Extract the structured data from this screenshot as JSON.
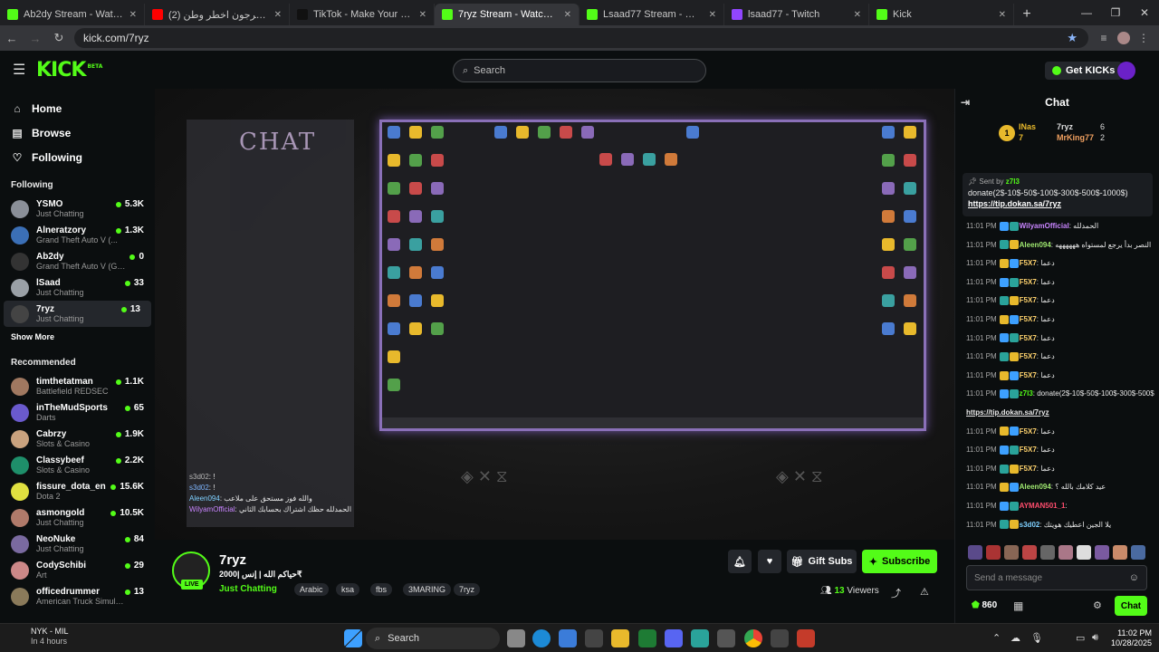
{
  "browser": {
    "tabs": [
      {
        "title": "Ab2dy Stream - Watch Live on K",
        "favicon_color": "#53fc18",
        "active": false
      },
      {
        "title": "اعضاء باور يحرجون اخطر وطن (2)",
        "favicon_color": "#ff0000",
        "active": false
      },
      {
        "title": "TikTok - Make Your Day",
        "favicon_color": "#111111",
        "active": false
      },
      {
        "title": "7ryz Stream - Watch Live on",
        "favicon_color": "#53fc18",
        "active": true
      },
      {
        "title": "Lsaad77 Stream - Watch Live o",
        "favicon_color": "#53fc18",
        "active": false
      },
      {
        "title": "lsaad77 - Twitch",
        "favicon_color": "#9146ff",
        "active": false
      },
      {
        "title": "Kick",
        "favicon_color": "#53fc18",
        "active": false
      }
    ],
    "url": "kick.com/7ryz"
  },
  "header": {
    "logo": "KICK",
    "logo_badge": "BETA",
    "search_placeholder": "Search",
    "get_kicks": "Get KICKs"
  },
  "sidebar": {
    "nav": [
      {
        "label": "Home",
        "icon": "home-icon"
      },
      {
        "label": "Browse",
        "icon": "browse-icon"
      },
      {
        "label": "Following",
        "icon": "heart-icon"
      }
    ],
    "following_title": "Following",
    "following": [
      {
        "name": "YSMO",
        "game": "Just Chatting",
        "viewers": "5.3K",
        "color": "#8a8f98"
      },
      {
        "name": "Alneratzory",
        "game": "Grand Theft Auto V (...",
        "viewers": "1.3K",
        "color": "#3b6fb6"
      },
      {
        "name": "Ab2dy",
        "game": "Grand Theft Auto V (GTA)",
        "viewers": "0",
        "color": "#333333"
      },
      {
        "name": "lSaad",
        "game": "Just Chatting",
        "viewers": "33",
        "color": "#9aa0a6"
      },
      {
        "name": "7ryz",
        "game": "Just Chatting",
        "viewers": "13",
        "color": "#444444"
      }
    ],
    "show_more": "Show More",
    "recommended_title": "Recommended",
    "recommended": [
      {
        "name": "timthetatman",
        "game": "Battlefield REDSEC",
        "viewers": "1.1K",
        "color": "#a07860"
      },
      {
        "name": "inTheMudSports",
        "game": "Darts",
        "viewers": "65",
        "color": "#6a5acd"
      },
      {
        "name": "Cabrzy",
        "game": "Slots & Casino",
        "viewers": "1.9K",
        "color": "#c9a27e"
      },
      {
        "name": "Classybeef",
        "game": "Slots & Casino",
        "viewers": "2.2K",
        "color": "#1e8f6a"
      },
      {
        "name": "fissure_dota_en",
        "game": "Dota 2",
        "viewers": "15.6K",
        "color": "#e0e040"
      },
      {
        "name": "asmongold",
        "game": "Just Chatting",
        "viewers": "10.5K",
        "color": "#b07a6a"
      },
      {
        "name": "NeoNuke",
        "game": "Just Chatting",
        "viewers": "84",
        "color": "#7a6aa0"
      },
      {
        "name": "CodySchibi",
        "game": "Art",
        "viewers": "29",
        "color": "#cc8888"
      },
      {
        "name": "officedrummer",
        "game": "American Truck Simulator",
        "viewers": "13",
        "color": "#8a7a5a"
      }
    ]
  },
  "player": {
    "chat_label": "CHAT",
    "overlay_chat": [
      {
        "user": "s3d02",
        "text": "!"
      },
      {
        "user": "s3d02",
        "text": "!"
      },
      {
        "user": "Aleen094",
        "text": "والله فوز مستحق على ملاعب"
      },
      {
        "user": "WilyamOfficial",
        "text": "الحمدلله حظك اشتراك بحسابك الثاني"
      }
    ]
  },
  "stream": {
    "name": "7ryz",
    "title": "حياكم الله | إنس |2000₹",
    "category": "Just Chatting",
    "tags": [
      "Arabic",
      "ksa",
      "fbs",
      "3MARING",
      "7ryz"
    ],
    "live": "LIVE",
    "gift_subs": "Gift Subs",
    "subscribe": "Subscribe",
    "viewers": "13",
    "viewers_label": "Viewers"
  },
  "chat": {
    "title": "Chat",
    "leaderboard": [
      {
        "name": "INas",
        "count": "7"
      },
      {
        "name": "7ryz",
        "count": "6"
      },
      {
        "name": "MrKing77",
        "count": "2"
      }
    ],
    "pinned": {
      "sent_by": "Sent by",
      "user": "z7l3",
      "text": "donate(2$-10$-50$-100$-300$-500$-1000$)",
      "link": "https://tip.dokan.sa/7ryz"
    },
    "messages": [
      {
        "time": "11:01 PM",
        "user": "WilyamOfficial",
        "text": "الحمدلله",
        "color": "#c985ff"
      },
      {
        "time": "11:01 PM",
        "user": "Aleen094",
        "text": "النصر بدأ يرجع لمستواه ههههههه",
        "color": "#9fe870"
      },
      {
        "time": "11:01 PM",
        "user": "F5X7",
        "text": "دعما",
        "color": "#ffd36e"
      },
      {
        "time": "11:01 PM",
        "user": "F5X7",
        "text": "دعما",
        "color": "#ffd36e"
      },
      {
        "time": "11:01 PM",
        "user": "F5X7",
        "text": "دعما",
        "color": "#ffd36e"
      },
      {
        "time": "11:01 PM",
        "user": "F5X7",
        "text": "دعما",
        "color": "#ffd36e"
      },
      {
        "time": "11:01 PM",
        "user": "F5X7",
        "text": "دعما",
        "color": "#ffd36e"
      },
      {
        "time": "11:01 PM",
        "user": "F5X7",
        "text": "دعما",
        "color": "#ffd36e"
      },
      {
        "time": "11:01 PM",
        "user": "F5X7",
        "text": "دعما",
        "color": "#ffd36e"
      },
      {
        "time": "11:01 PM",
        "user": "z7l3",
        "text": "donate(2$-10$-50$-100$-300$-500$-1000$)",
        "color": "#53fc18"
      },
      {
        "time": "",
        "user": "",
        "text": "https://tip.dokan.sa/7ryz",
        "color": "#ffffff"
      },
      {
        "time": "11:01 PM",
        "user": "F5X7",
        "text": "دعما",
        "color": "#ffd36e"
      },
      {
        "time": "11:01 PM",
        "user": "F5X7",
        "text": "دعما",
        "color": "#ffd36e"
      },
      {
        "time": "11:01 PM",
        "user": "F5X7",
        "text": "دعما",
        "color": "#ffd36e"
      },
      {
        "time": "11:01 PM",
        "user": "Aleen094",
        "text": "عيد كلامك بالله ؟",
        "color": "#9fe870"
      },
      {
        "time": "11:01 PM",
        "user": "AYMAN501_1",
        "text": "",
        "color": "#ff4d6d"
      },
      {
        "time": "11:01 PM",
        "user": "s3d02",
        "text": "يلا الجين اعطيك هويتك",
        "color": "#7fd0ff"
      }
    ],
    "input_placeholder": "Send a message",
    "points": "860",
    "chat_button": "Chat"
  },
  "taskbar": {
    "weather_title": "NYK - MIL",
    "weather_sub": "In 4 hours",
    "search": "Search",
    "time": "11:02 PM",
    "date": "10/28/2025"
  }
}
